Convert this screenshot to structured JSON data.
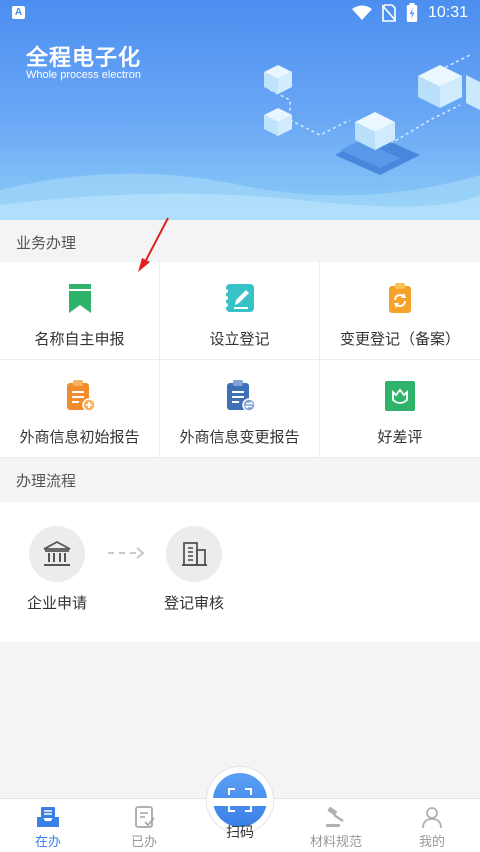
{
  "status_bar": {
    "badge": "A",
    "time": "10:31"
  },
  "hero": {
    "title": "全程电子化",
    "subtitle": "Whole process electron"
  },
  "business": {
    "header": "业务办理",
    "items": [
      {
        "label": "名称自主申报",
        "icon": "bookmark-icon",
        "color": "#2fb36b"
      },
      {
        "label": "设立登记",
        "icon": "notebook-edit-icon",
        "color": "#36c2c7"
      },
      {
        "label": "变更登记（备案）",
        "icon": "clipboard-refresh-icon",
        "color": "#f5a229"
      },
      {
        "label": "外商信息初始报告",
        "icon": "clipboard-add-icon",
        "color": "#f08c2c"
      },
      {
        "label": "外商信息变更报告",
        "icon": "clipboard-exchange-icon",
        "color": "#3f6fb5"
      },
      {
        "label": "好差评",
        "icon": "flower-badge-icon",
        "color": "#2fb36b"
      }
    ]
  },
  "process": {
    "header": "办理流程",
    "steps": [
      {
        "label": "企业申请",
        "icon": "bank-building-icon"
      },
      {
        "label": "登记审核",
        "icon": "office-building-icon"
      }
    ]
  },
  "tabbar": {
    "tabs": [
      {
        "label": "在办",
        "icon": "inbox-tray-icon",
        "active": true
      },
      {
        "label": "已办",
        "icon": "checklist-icon",
        "active": false
      },
      {
        "label": "扫码",
        "icon": "scan-icon",
        "active": false
      },
      {
        "label": "材料规范",
        "icon": "gavel-icon",
        "active": false
      },
      {
        "label": "我的",
        "icon": "user-icon",
        "active": false
      }
    ]
  },
  "colors": {
    "accent": "#3a7fe6",
    "hero_top": "#4c8ef0",
    "hero_bottom": "#8dcdf8",
    "annotation": "#e02020"
  }
}
